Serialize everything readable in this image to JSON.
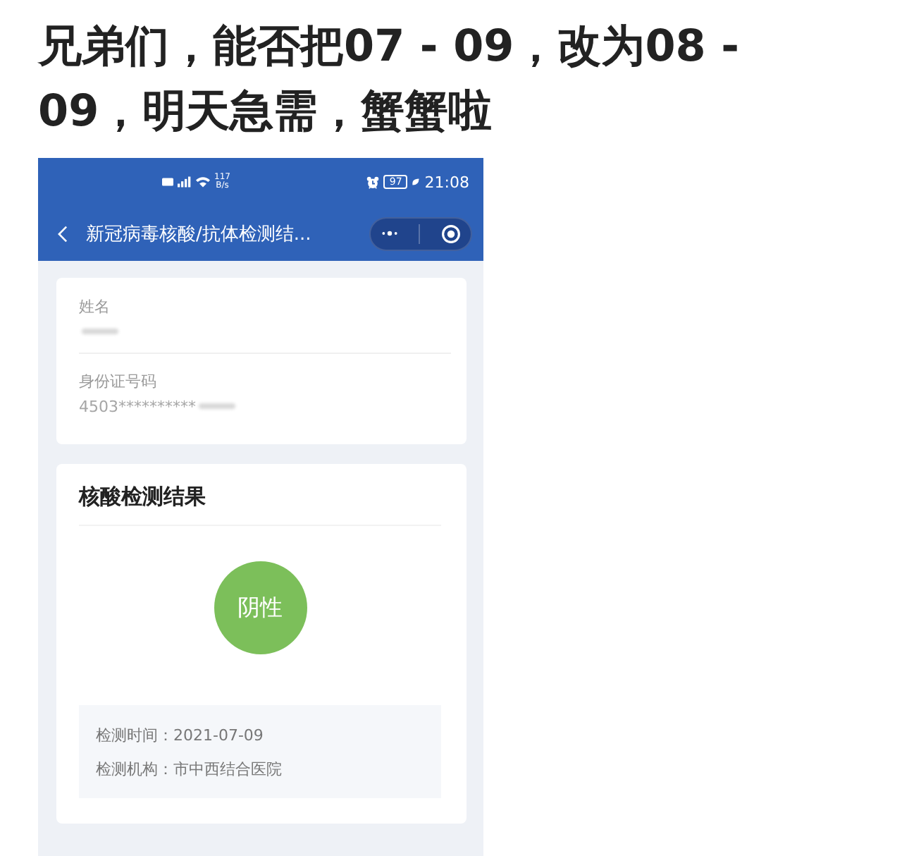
{
  "post": {
    "title": "兄弟们，能否把07 - 09，改为08 - 09，明天急需，蟹蟹啦"
  },
  "status_bar": {
    "speed": "117",
    "speed_unit": "B/s",
    "battery": "97",
    "time": "21:08"
  },
  "nav": {
    "title": "新冠病毒核酸/抗体检测结..."
  },
  "identity": {
    "fields": [
      {
        "label": "姓名",
        "redacted": true
      },
      {
        "label": "身份证号码",
        "value": "4503**********",
        "redacted": true
      }
    ]
  },
  "result": {
    "title": "核酸检测结果",
    "verdict": "阴性",
    "details": [
      {
        "label": "检测时间：",
        "value": "2021-07-09"
      },
      {
        "label": "检测机构：",
        "value": "市中西结合医院"
      }
    ]
  }
}
